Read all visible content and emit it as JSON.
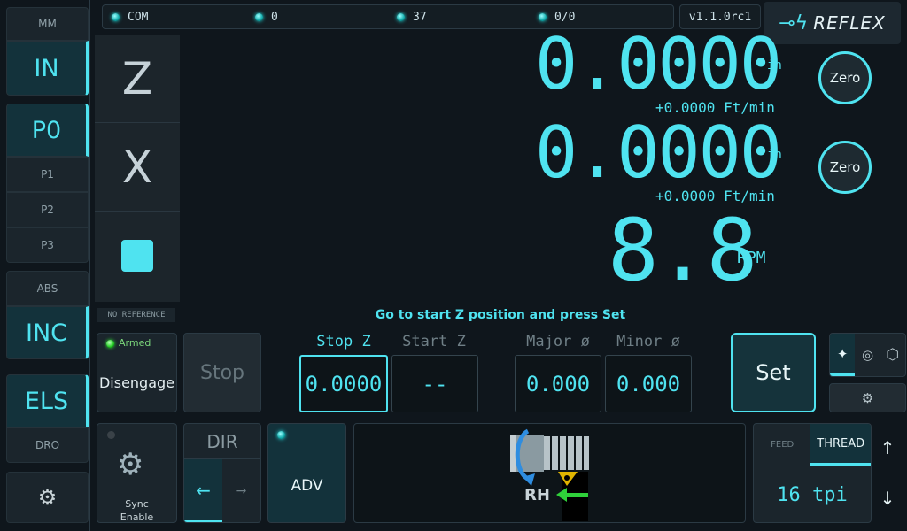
{
  "status": {
    "com": "COM",
    "a": "0",
    "b": "37",
    "c": "0/0",
    "version": "v1.1.0rc1",
    "brand": "REFLEX"
  },
  "left": {
    "mm": "MM",
    "inch": "IN",
    "p0": "P0",
    "p1": "P1",
    "p2": "P2",
    "p3": "P3",
    "abs": "ABS",
    "inc": "INC",
    "els": "ELS",
    "dro": "DRO"
  },
  "axes": {
    "z": "Z",
    "x": "X"
  },
  "readout": {
    "z_value": "0.0000",
    "z_unit": "in",
    "z_feed": "+0.0000 Ft/min",
    "x_value": "0.0000",
    "x_unit": "in",
    "x_feed": "+0.0000 Ft/min",
    "rpm_value": "8.8",
    "rpm_unit": "RPM",
    "zero_label": "Zero"
  },
  "messages": {
    "no_reference": "NO REFERENCE",
    "prompt": "Go to start Z position and press Set"
  },
  "controls": {
    "armed": "Armed",
    "disengage": "Disengage",
    "stop": "Stop",
    "stop_z": "Stop Z",
    "start_z": "Start Z",
    "major": "Major ø",
    "minor": "Minor ø",
    "stop_z_value": "0.0000",
    "start_z_value": "--",
    "major_value": "0.000",
    "minor_value": "0.000",
    "set": "Set"
  },
  "bottom": {
    "sync_line1": "Sync",
    "sync_line2": "Enable",
    "dir": "DIR",
    "dir_left": "←",
    "dir_right": "→",
    "adv": "ADV",
    "rh": "RH",
    "feed": "FEED",
    "thread": "THREAD",
    "tpi": "16 tpi"
  }
}
